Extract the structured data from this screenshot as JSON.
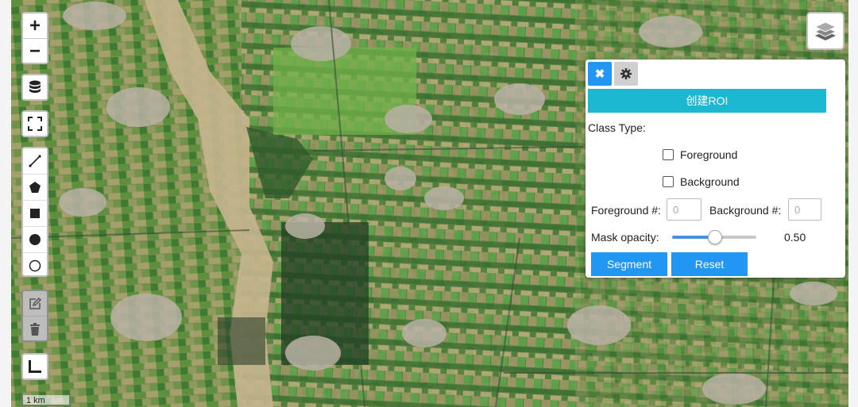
{
  "map": {
    "zoom_in_label": "+",
    "zoom_out_label": "−",
    "scale_label": "1 km",
    "icons": [
      "database-icon",
      "fullscreen-icon",
      "polyline-icon",
      "polygon-icon",
      "rectangle-icon",
      "circle-marker-icon",
      "circle-icon",
      "edit-icon",
      "trash-icon",
      "measure-icon",
      "layers-icon"
    ]
  },
  "panel": {
    "close_label": "✖",
    "create_roi_label": "创建ROI",
    "class_type_label": "Class Type:",
    "foreground_label": "Foreground",
    "background_label": "Background",
    "foreground_count_label": "Foreground #:",
    "foreground_count_value": "0",
    "background_count_label": "Background #:",
    "background_count_value": "0",
    "mask_opacity_label": "Mask opacity:",
    "mask_opacity_value": "0.50",
    "mask_opacity_fraction": 0.5,
    "segment_label": "Segment",
    "reset_label": "Reset"
  },
  "colors": {
    "accent_blue": "#2196f3",
    "roi_cyan": "#1cb8d2"
  }
}
